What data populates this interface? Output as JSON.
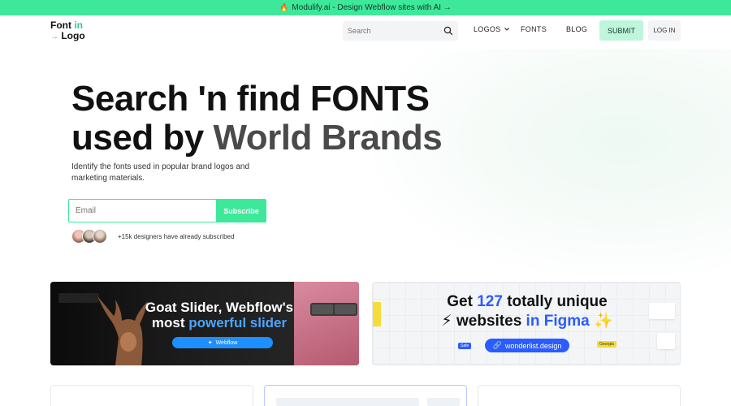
{
  "promo": {
    "text": "Modulify.ai - Design Webflow sites with AI →",
    "icon": "fire-icon"
  },
  "nav": {
    "logo_line1": "Font",
    "logo_in": "in",
    "logo_arrow": "→",
    "logo_line2": "Logo",
    "search_placeholder": "Search",
    "links": {
      "logos": "LOGOS",
      "fonts": "FONTS",
      "blog": "BLOG"
    },
    "submit": "SUBMIT",
    "login": "LOG IN"
  },
  "hero": {
    "title_line1": "Search 'n find FONTS",
    "title_line2_a": "used by",
    "title_line2_b": "World Brands",
    "subtitle": "Identify the fonts used in popular brand logos and marketing materials.",
    "email_placeholder": "Email",
    "subscribe": "Subscribe",
    "social_proof": "+15k designers have already subscribed"
  },
  "banners": {
    "b1": {
      "title_a": "Goat Slider, Webflow's",
      "title_b": "most",
      "title_c": "powerful slider",
      "badge": "Webflow"
    },
    "b2": {
      "title_a": "Get",
      "title_num": "127",
      "title_b": "totally unique",
      "title_c": "websites",
      "title_d": "in Figma",
      "pill": "wonderlist.design",
      "tag_safe": "Safe",
      "tag_georgia": "Georgia"
    }
  },
  "colors": {
    "accent": "#3ee89a",
    "blue": "#2b5cff"
  }
}
